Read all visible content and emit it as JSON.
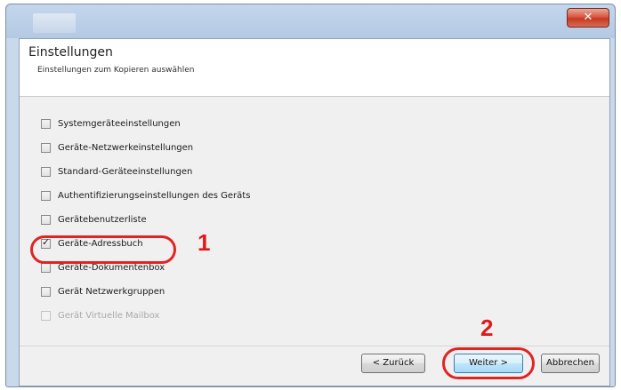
{
  "window": {
    "close_label": "✕"
  },
  "header": {
    "title": "Einstellungen",
    "subtitle": "Einstellungen zum Kopieren auswählen"
  },
  "options": [
    {
      "label": "Systemgeräteeinstellungen",
      "checked": false,
      "disabled": false
    },
    {
      "label": "Geräte-Netzwerkeinstellungen",
      "checked": false,
      "disabled": false
    },
    {
      "label": "Standard-Geräteeinstellungen",
      "checked": false,
      "disabled": false
    },
    {
      "label": "Authentifizierungseinstellungen des Geräts",
      "checked": false,
      "disabled": false
    },
    {
      "label": "Gerätebenutzerliste",
      "checked": false,
      "disabled": false
    },
    {
      "label": "Geräte-Adressbuch",
      "checked": true,
      "disabled": false
    },
    {
      "label": "Geräte-Dokumentenbox",
      "checked": false,
      "disabled": false
    },
    {
      "label": "Gerät Netzwerkgruppen",
      "checked": false,
      "disabled": false
    },
    {
      "label": "Gerät Virtuelle Mailbox",
      "checked": false,
      "disabled": true
    }
  ],
  "callouts": {
    "step1": "1",
    "step2": "2"
  },
  "buttons": {
    "back": "< Zurück",
    "next": "Weiter >",
    "cancel": "Abbrechen"
  },
  "colors": {
    "callout_red": "#e02424"
  }
}
